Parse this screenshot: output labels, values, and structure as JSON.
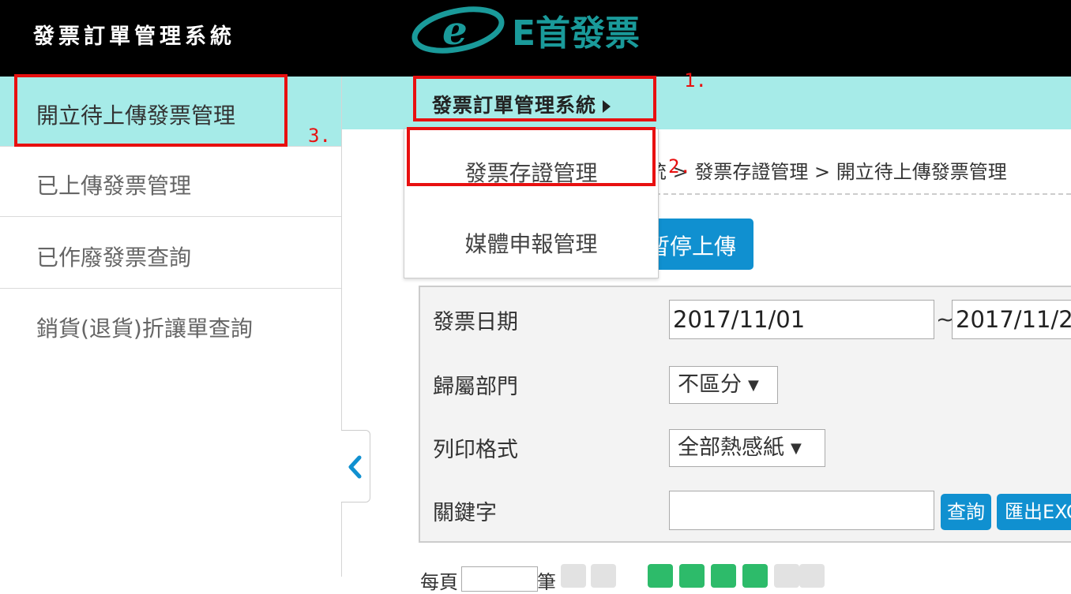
{
  "header": {
    "title": "發票訂單管理系統",
    "logo_text": "E首發票",
    "logo_letter": "e",
    "logo_color": "#1a9a9a"
  },
  "sidebar": {
    "items": [
      {
        "label": "開立待上傳發票管理",
        "active": true
      },
      {
        "label": "已上傳發票管理",
        "active": false
      },
      {
        "label": "已作廢發票查詢",
        "active": false
      },
      {
        "label": "銷貨(退貨)折讓單查詢",
        "active": false
      }
    ],
    "collapse_icon": "chevron-left-icon"
  },
  "navbar": {
    "menu_label": "發票訂單管理系統",
    "caret_icon": "caret-right-icon",
    "background": "#a6ebe8"
  },
  "dropdown": {
    "items": [
      "發票存證管理",
      "媒體申報管理"
    ]
  },
  "breadcrumb": "統 > 發票存證管理 > 開立待上傳發票管理",
  "actions": {
    "pause_upload": "暫停上傳"
  },
  "form": {
    "invoice_date_label": "發票日期",
    "date_from": "2017/11/01",
    "date_separator": "~",
    "date_to": "2017/11/2",
    "department_label": "歸屬部門",
    "department_value": "不區分",
    "print_format_label": "列印格式",
    "print_format_value": "全部熱感紙",
    "keyword_label": "關鍵字",
    "keyword_value": "",
    "search_button": "查詢",
    "export_button": "匯出EXC",
    "select_arrow": "▼"
  },
  "pager": {
    "per_page_prefix": "每頁",
    "per_page_suffix": "筆"
  },
  "annotations": {
    "labels": [
      "1.",
      "2.",
      "3."
    ],
    "color": "#e81010"
  },
  "colors": {
    "accent_blue": "#1090d0",
    "pager_green": "#2dbb6a"
  }
}
